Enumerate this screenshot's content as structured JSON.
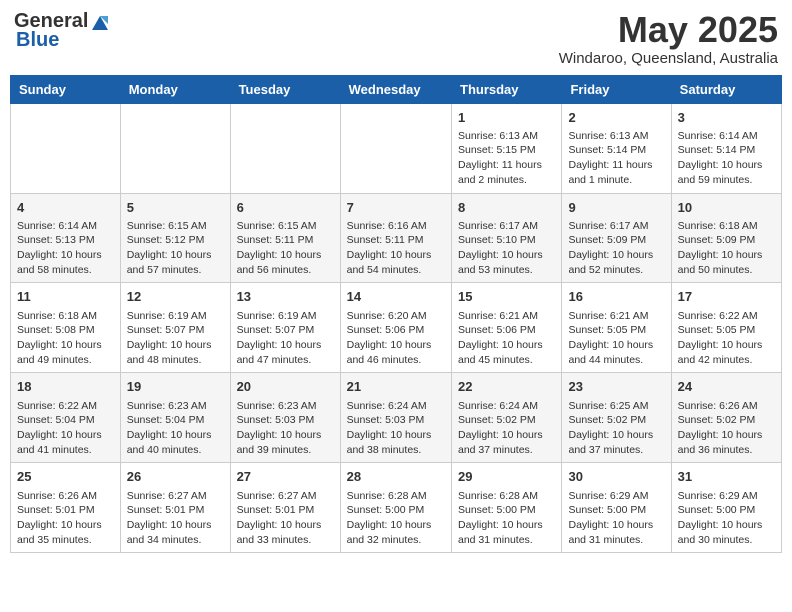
{
  "header": {
    "logo_general": "General",
    "logo_blue": "Blue",
    "month_title": "May 2025",
    "location": "Windaroo, Queensland, Australia"
  },
  "days_of_week": [
    "Sunday",
    "Monday",
    "Tuesday",
    "Wednesday",
    "Thursday",
    "Friday",
    "Saturday"
  ],
  "weeks": [
    [
      {
        "day": "",
        "info": ""
      },
      {
        "day": "",
        "info": ""
      },
      {
        "day": "",
        "info": ""
      },
      {
        "day": "",
        "info": ""
      },
      {
        "day": "1",
        "info": "Sunrise: 6:13 AM\nSunset: 5:15 PM\nDaylight: 11 hours\nand 2 minutes."
      },
      {
        "day": "2",
        "info": "Sunrise: 6:13 AM\nSunset: 5:14 PM\nDaylight: 11 hours\nand 1 minute."
      },
      {
        "day": "3",
        "info": "Sunrise: 6:14 AM\nSunset: 5:14 PM\nDaylight: 10 hours\nand 59 minutes."
      }
    ],
    [
      {
        "day": "4",
        "info": "Sunrise: 6:14 AM\nSunset: 5:13 PM\nDaylight: 10 hours\nand 58 minutes."
      },
      {
        "day": "5",
        "info": "Sunrise: 6:15 AM\nSunset: 5:12 PM\nDaylight: 10 hours\nand 57 minutes."
      },
      {
        "day": "6",
        "info": "Sunrise: 6:15 AM\nSunset: 5:11 PM\nDaylight: 10 hours\nand 56 minutes."
      },
      {
        "day": "7",
        "info": "Sunrise: 6:16 AM\nSunset: 5:11 PM\nDaylight: 10 hours\nand 54 minutes."
      },
      {
        "day": "8",
        "info": "Sunrise: 6:17 AM\nSunset: 5:10 PM\nDaylight: 10 hours\nand 53 minutes."
      },
      {
        "day": "9",
        "info": "Sunrise: 6:17 AM\nSunset: 5:09 PM\nDaylight: 10 hours\nand 52 minutes."
      },
      {
        "day": "10",
        "info": "Sunrise: 6:18 AM\nSunset: 5:09 PM\nDaylight: 10 hours\nand 50 minutes."
      }
    ],
    [
      {
        "day": "11",
        "info": "Sunrise: 6:18 AM\nSunset: 5:08 PM\nDaylight: 10 hours\nand 49 minutes."
      },
      {
        "day": "12",
        "info": "Sunrise: 6:19 AM\nSunset: 5:07 PM\nDaylight: 10 hours\nand 48 minutes."
      },
      {
        "day": "13",
        "info": "Sunrise: 6:19 AM\nSunset: 5:07 PM\nDaylight: 10 hours\nand 47 minutes."
      },
      {
        "day": "14",
        "info": "Sunrise: 6:20 AM\nSunset: 5:06 PM\nDaylight: 10 hours\nand 46 minutes."
      },
      {
        "day": "15",
        "info": "Sunrise: 6:21 AM\nSunset: 5:06 PM\nDaylight: 10 hours\nand 45 minutes."
      },
      {
        "day": "16",
        "info": "Sunrise: 6:21 AM\nSunset: 5:05 PM\nDaylight: 10 hours\nand 44 minutes."
      },
      {
        "day": "17",
        "info": "Sunrise: 6:22 AM\nSunset: 5:05 PM\nDaylight: 10 hours\nand 42 minutes."
      }
    ],
    [
      {
        "day": "18",
        "info": "Sunrise: 6:22 AM\nSunset: 5:04 PM\nDaylight: 10 hours\nand 41 minutes."
      },
      {
        "day": "19",
        "info": "Sunrise: 6:23 AM\nSunset: 5:04 PM\nDaylight: 10 hours\nand 40 minutes."
      },
      {
        "day": "20",
        "info": "Sunrise: 6:23 AM\nSunset: 5:03 PM\nDaylight: 10 hours\nand 39 minutes."
      },
      {
        "day": "21",
        "info": "Sunrise: 6:24 AM\nSunset: 5:03 PM\nDaylight: 10 hours\nand 38 minutes."
      },
      {
        "day": "22",
        "info": "Sunrise: 6:24 AM\nSunset: 5:02 PM\nDaylight: 10 hours\nand 37 minutes."
      },
      {
        "day": "23",
        "info": "Sunrise: 6:25 AM\nSunset: 5:02 PM\nDaylight: 10 hours\nand 37 minutes."
      },
      {
        "day": "24",
        "info": "Sunrise: 6:26 AM\nSunset: 5:02 PM\nDaylight: 10 hours\nand 36 minutes."
      }
    ],
    [
      {
        "day": "25",
        "info": "Sunrise: 6:26 AM\nSunset: 5:01 PM\nDaylight: 10 hours\nand 35 minutes."
      },
      {
        "day": "26",
        "info": "Sunrise: 6:27 AM\nSunset: 5:01 PM\nDaylight: 10 hours\nand 34 minutes."
      },
      {
        "day": "27",
        "info": "Sunrise: 6:27 AM\nSunset: 5:01 PM\nDaylight: 10 hours\nand 33 minutes."
      },
      {
        "day": "28",
        "info": "Sunrise: 6:28 AM\nSunset: 5:00 PM\nDaylight: 10 hours\nand 32 minutes."
      },
      {
        "day": "29",
        "info": "Sunrise: 6:28 AM\nSunset: 5:00 PM\nDaylight: 10 hours\nand 31 minutes."
      },
      {
        "day": "30",
        "info": "Sunrise: 6:29 AM\nSunset: 5:00 PM\nDaylight: 10 hours\nand 31 minutes."
      },
      {
        "day": "31",
        "info": "Sunrise: 6:29 AM\nSunset: 5:00 PM\nDaylight: 10 hours\nand 30 minutes."
      }
    ]
  ]
}
